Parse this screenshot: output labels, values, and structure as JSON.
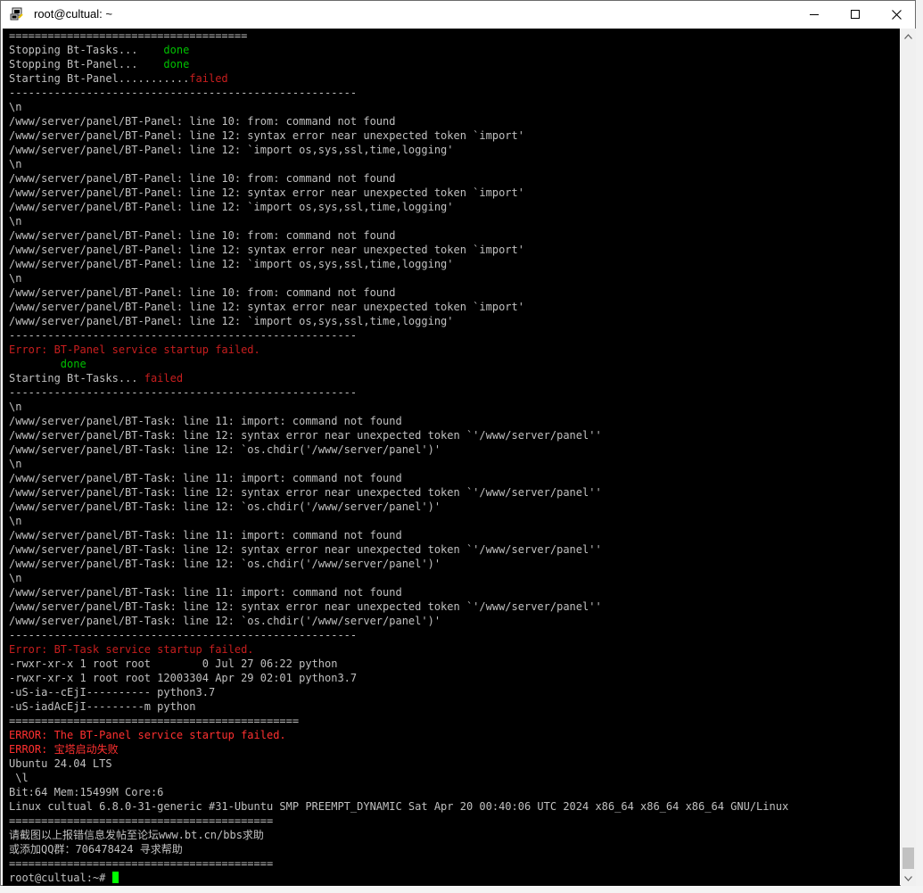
{
  "window": {
    "title": "root@cultual: ~"
  },
  "terminal": {
    "lines": [
      {
        "segs": [
          {
            "t": "=====================================",
            "c": ""
          }
        ]
      },
      {
        "segs": [
          {
            "t": "Stopping Bt-Tasks...    ",
            "c": ""
          },
          {
            "t": "done",
            "c": "green"
          }
        ]
      },
      {
        "segs": [
          {
            "t": "Stopping Bt-Panel...    ",
            "c": ""
          },
          {
            "t": "done",
            "c": "green"
          }
        ]
      },
      {
        "segs": [
          {
            "t": "Starting Bt-Panel...........",
            "c": ""
          },
          {
            "t": "failed",
            "c": "red"
          }
        ]
      },
      {
        "segs": [
          {
            "t": "------------------------------------------------------",
            "c": ""
          }
        ]
      },
      {
        "segs": [
          {
            "t": "\\n",
            "c": ""
          }
        ]
      },
      {
        "segs": [
          {
            "t": "/www/server/panel/BT-Panel: line 10: from: command not found",
            "c": ""
          }
        ]
      },
      {
        "segs": [
          {
            "t": "/www/server/panel/BT-Panel: line 12: syntax error near unexpected token `import'",
            "c": ""
          }
        ]
      },
      {
        "segs": [
          {
            "t": "/www/server/panel/BT-Panel: line 12: `import os,sys,ssl,time,logging'",
            "c": ""
          }
        ]
      },
      {
        "segs": [
          {
            "t": "\\n",
            "c": ""
          }
        ]
      },
      {
        "segs": [
          {
            "t": "/www/server/panel/BT-Panel: line 10: from: command not found",
            "c": ""
          }
        ]
      },
      {
        "segs": [
          {
            "t": "/www/server/panel/BT-Panel: line 12: syntax error near unexpected token `import'",
            "c": ""
          }
        ]
      },
      {
        "segs": [
          {
            "t": "/www/server/panel/BT-Panel: line 12: `import os,sys,ssl,time,logging'",
            "c": ""
          }
        ]
      },
      {
        "segs": [
          {
            "t": "\\n",
            "c": ""
          }
        ]
      },
      {
        "segs": [
          {
            "t": "/www/server/panel/BT-Panel: line 10: from: command not found",
            "c": ""
          }
        ]
      },
      {
        "segs": [
          {
            "t": "/www/server/panel/BT-Panel: line 12: syntax error near unexpected token `import'",
            "c": ""
          }
        ]
      },
      {
        "segs": [
          {
            "t": "/www/server/panel/BT-Panel: line 12: `import os,sys,ssl,time,logging'",
            "c": ""
          }
        ]
      },
      {
        "segs": [
          {
            "t": "\\n",
            "c": ""
          }
        ]
      },
      {
        "segs": [
          {
            "t": "/www/server/panel/BT-Panel: line 10: from: command not found",
            "c": ""
          }
        ]
      },
      {
        "segs": [
          {
            "t": "/www/server/panel/BT-Panel: line 12: syntax error near unexpected token `import'",
            "c": ""
          }
        ]
      },
      {
        "segs": [
          {
            "t": "/www/server/panel/BT-Panel: line 12: `import os,sys,ssl,time,logging'",
            "c": ""
          }
        ]
      },
      {
        "segs": [
          {
            "t": "------------------------------------------------------",
            "c": ""
          }
        ]
      },
      {
        "segs": [
          {
            "t": "Error: BT-Panel service startup failed.",
            "c": "red"
          }
        ]
      },
      {
        "segs": [
          {
            "t": "        ",
            "c": ""
          },
          {
            "t": "done",
            "c": "green"
          }
        ]
      },
      {
        "segs": [
          {
            "t": "Starting Bt-Tasks... ",
            "c": ""
          },
          {
            "t": "failed",
            "c": "red"
          }
        ]
      },
      {
        "segs": [
          {
            "t": "------------------------------------------------------",
            "c": ""
          }
        ]
      },
      {
        "segs": [
          {
            "t": "\\n",
            "c": ""
          }
        ]
      },
      {
        "segs": [
          {
            "t": "/www/server/panel/BT-Task: line 11: import: command not found",
            "c": ""
          }
        ]
      },
      {
        "segs": [
          {
            "t": "/www/server/panel/BT-Task: line 12: syntax error near unexpected token `'/www/server/panel''",
            "c": ""
          }
        ]
      },
      {
        "segs": [
          {
            "t": "/www/server/panel/BT-Task: line 12: `os.chdir('/www/server/panel')'",
            "c": ""
          }
        ]
      },
      {
        "segs": [
          {
            "t": "\\n",
            "c": ""
          }
        ]
      },
      {
        "segs": [
          {
            "t": "/www/server/panel/BT-Task: line 11: import: command not found",
            "c": ""
          }
        ]
      },
      {
        "segs": [
          {
            "t": "/www/server/panel/BT-Task: line 12: syntax error near unexpected token `'/www/server/panel''",
            "c": ""
          }
        ]
      },
      {
        "segs": [
          {
            "t": "/www/server/panel/BT-Task: line 12: `os.chdir('/www/server/panel')'",
            "c": ""
          }
        ]
      },
      {
        "segs": [
          {
            "t": "\\n",
            "c": ""
          }
        ]
      },
      {
        "segs": [
          {
            "t": "/www/server/panel/BT-Task: line 11: import: command not found",
            "c": ""
          }
        ]
      },
      {
        "segs": [
          {
            "t": "/www/server/panel/BT-Task: line 12: syntax error near unexpected token `'/www/server/panel''",
            "c": ""
          }
        ]
      },
      {
        "segs": [
          {
            "t": "/www/server/panel/BT-Task: line 12: `os.chdir('/www/server/panel')'",
            "c": ""
          }
        ]
      },
      {
        "segs": [
          {
            "t": "\\n",
            "c": ""
          }
        ]
      },
      {
        "segs": [
          {
            "t": "/www/server/panel/BT-Task: line 11: import: command not found",
            "c": ""
          }
        ]
      },
      {
        "segs": [
          {
            "t": "/www/server/panel/BT-Task: line 12: syntax error near unexpected token `'/www/server/panel''",
            "c": ""
          }
        ]
      },
      {
        "segs": [
          {
            "t": "/www/server/panel/BT-Task: line 12: `os.chdir('/www/server/panel')'",
            "c": ""
          }
        ]
      },
      {
        "segs": [
          {
            "t": "------------------------------------------------------",
            "c": ""
          }
        ]
      },
      {
        "segs": [
          {
            "t": "Error: BT-Task service startup failed.",
            "c": "red"
          }
        ]
      },
      {
        "segs": [
          {
            "t": "-rwxr-xr-x 1 root root        0 Jul 27 06:22 python",
            "c": ""
          }
        ]
      },
      {
        "segs": [
          {
            "t": "-rwxr-xr-x 1 root root 12003304 Apr 29 02:01 python3.7",
            "c": ""
          }
        ]
      },
      {
        "segs": [
          {
            "t": "-uS-ia--cEjI---------- python3.7",
            "c": ""
          }
        ]
      },
      {
        "segs": [
          {
            "t": "-uS-iadAcEjI---------m python",
            "c": ""
          }
        ]
      },
      {
        "segs": [
          {
            "t": "=============================================",
            "c": ""
          }
        ]
      },
      {
        "segs": [
          {
            "t": "ERROR: The BT-Panel service startup failed.",
            "c": "redb"
          }
        ]
      },
      {
        "segs": [
          {
            "t": "ERROR: 宝塔启动失败",
            "c": "redb"
          }
        ]
      },
      {
        "segs": [
          {
            "t": "Ubuntu 24.04 LTS",
            "c": ""
          }
        ]
      },
      {
        "segs": [
          {
            "t": " \\l",
            "c": ""
          }
        ]
      },
      {
        "segs": [
          {
            "t": "Bit:64 Mem:15499M Core:6",
            "c": ""
          }
        ]
      },
      {
        "segs": [
          {
            "t": "Linux cultual 6.8.0-31-generic #31-Ubuntu SMP PREEMPT_DYNAMIC Sat Apr 20 00:40:06 UTC 2024 x86_64 x86_64 x86_64 GNU/Linux",
            "c": ""
          }
        ]
      },
      {
        "segs": [
          {
            "t": "=========================================",
            "c": ""
          }
        ]
      },
      {
        "segs": [
          {
            "t": "请截图以上报错信息发帖至论坛www.bt.cn/bbs求助",
            "c": ""
          }
        ]
      },
      {
        "segs": [
          {
            "t": "或添加QQ群：706478424 寻求帮助",
            "c": ""
          }
        ]
      },
      {
        "segs": [
          {
            "t": "=========================================",
            "c": ""
          }
        ]
      }
    ],
    "prompt": "root@cultual:~# "
  },
  "colors": {
    "terminal_bg": "#000000",
    "text": "#c0c0c0",
    "ok": "#00c000",
    "fail": "#c81e1e",
    "cursor": "#00ff00"
  }
}
